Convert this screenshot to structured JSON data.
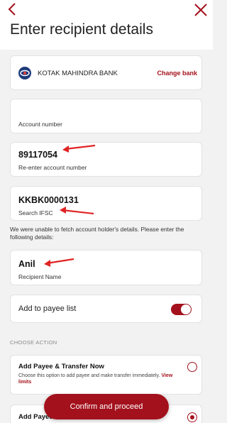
{
  "header": {
    "title": "Enter recipient details"
  },
  "bank": {
    "name": "KOTAK MAHINDRA BANK",
    "change_label": "Change bank"
  },
  "fields": {
    "account_number": {
      "value": "",
      "label": "Account number"
    },
    "reenter_account_number": {
      "value": "89117054",
      "label": "Re-enter account number"
    },
    "ifsc": {
      "value": "KKBK0000131",
      "label": "Search IFSC"
    },
    "recipient_name": {
      "value": "Anil",
      "label": "Recipient Name"
    }
  },
  "notice": "We were unable to fetch account holder's details. Please enter the following details:",
  "payee_toggle": {
    "label": "Add to payee list",
    "on": true
  },
  "choose_action": {
    "heading": "CHOOSE ACTION",
    "options": [
      {
        "title": "Add Payee & Transfer Now",
        "desc": "Choose this option to add payee and make transfer immediately.",
        "link": "View limits",
        "selected": false
      },
      {
        "title": "Add Payee & Transfer Later",
        "selected": true
      }
    ]
  },
  "cta": {
    "label": "Confirm and proceed"
  },
  "colors": {
    "accent": "#a3111c",
    "background": "#f2f2f2",
    "annotation_arrow": "#e02424"
  }
}
